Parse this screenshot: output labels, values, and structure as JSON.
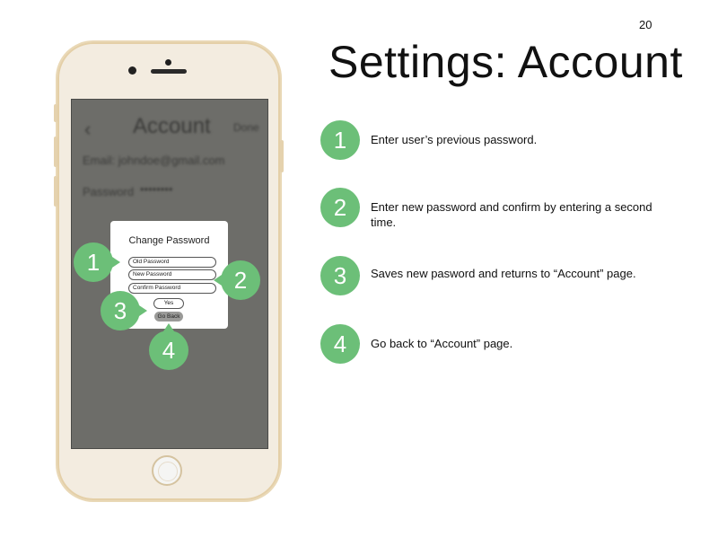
{
  "page_number": "20",
  "title": "Settings: Account",
  "colors": {
    "accent_green": "#6cbf78",
    "screen_overlay": "#6d6d69",
    "phone_gold": "#e4cfa7"
  },
  "background_screen": {
    "back_glyph": "‹",
    "title": "Account",
    "done_label": "Done",
    "email_line": "Email: johndoe@gmail.com",
    "password_label": "Password",
    "password_mask": "••••••••"
  },
  "dialog": {
    "title": "Change Password",
    "old_password_placeholder": "Old Password",
    "new_password_placeholder": "New Password",
    "confirm_password_placeholder": "Confirm Password",
    "yes_label": "Yes",
    "go_back_label": "Go Back"
  },
  "callouts": [
    "1",
    "2",
    "3",
    "4"
  ],
  "steps": [
    {
      "number": "1",
      "text": "Enter user’s previous password."
    },
    {
      "number": "2",
      "text": "Enter new password and confirm by entering a second time."
    },
    {
      "number": "3",
      "text": "Saves new pasword and returns to “Account” page."
    },
    {
      "number": "4",
      "text": "Go back to “Account” page."
    }
  ]
}
